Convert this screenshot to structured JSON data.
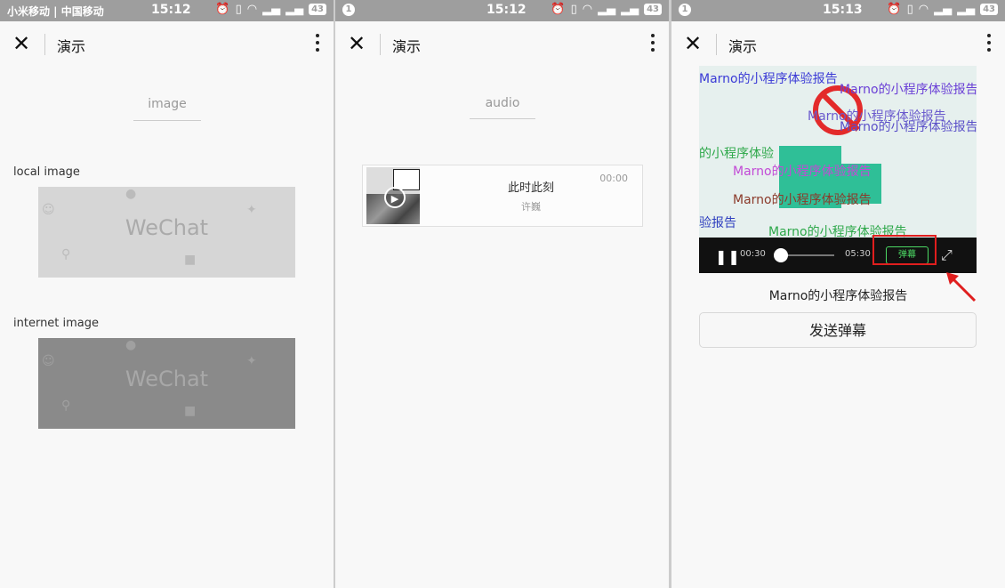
{
  "screens": [
    {
      "status": {
        "carrier": "小米移动 | 中国移动",
        "time": "15:12",
        "battery": "43"
      },
      "nav": {
        "title": "演示"
      },
      "section_title": "image",
      "local_label": "local image",
      "internet_label": "internet image",
      "image_text": "WeChat"
    },
    {
      "status": {
        "notif": "1",
        "time": "15:12",
        "battery": "43"
      },
      "nav": {
        "title": "演示"
      },
      "section_title": "audio",
      "audio": {
        "name": "此时此刻",
        "author": "许巍",
        "time": "00:00"
      }
    },
    {
      "status": {
        "notif": "1",
        "time": "15:13",
        "battery": "43"
      },
      "nav": {
        "title": "演示"
      },
      "video": {
        "current_time": "00:30",
        "duration": "05:30",
        "danmu_button": "弹幕",
        "danmu_text": "Marno的小程序体验报告",
        "danmu_partial_1": "的小程序体验",
        "danmu_partial_2": "验报告"
      },
      "caption": "Marno的小程序体验报告",
      "send_button": "发送弹幕"
    }
  ]
}
